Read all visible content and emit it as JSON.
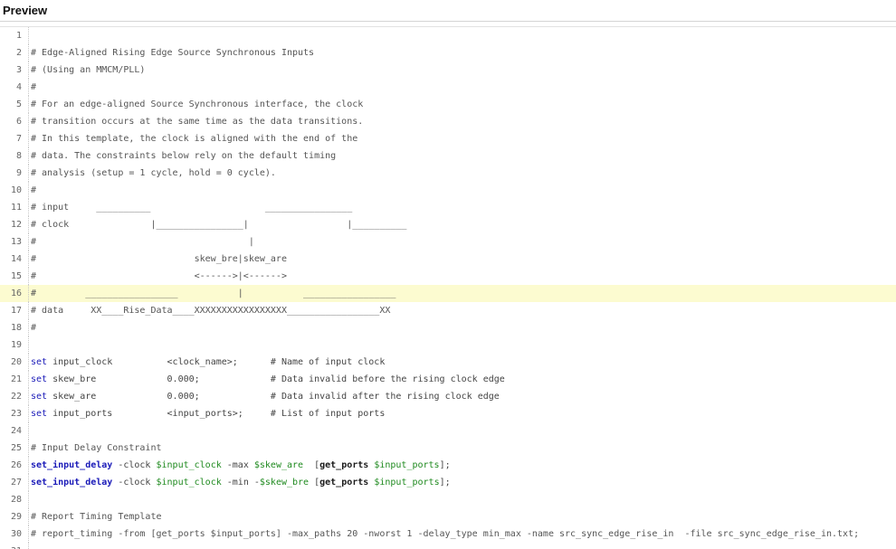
{
  "panel": {
    "title": "Preview"
  },
  "editor": {
    "highlight_line": 16,
    "lines": [
      {
        "n": "1",
        "text": ""
      },
      {
        "n": "2",
        "text": "# Edge-Aligned Rising Edge Source Synchronous Inputs"
      },
      {
        "n": "3",
        "text": "# (Using an MMCM/PLL)"
      },
      {
        "n": "4",
        "text": "#"
      },
      {
        "n": "5",
        "text": "# For an edge-aligned Source Synchronous interface, the clock"
      },
      {
        "n": "6",
        "text": "# transition occurs at the same time as the data transitions."
      },
      {
        "n": "7",
        "text": "# In this template, the clock is aligned with the end of the"
      },
      {
        "n": "8",
        "text": "# data. The constraints below rely on the default timing"
      },
      {
        "n": "9",
        "text": "# analysis (setup = 1 cycle, hold = 0 cycle)."
      },
      {
        "n": "10",
        "text": "#"
      },
      {
        "n": "11",
        "text": "# input     __________                     ________________"
      },
      {
        "n": "12",
        "text": "# clock               |________________|                  |__________"
      },
      {
        "n": "13",
        "text": "#                                       |"
      },
      {
        "n": "14",
        "text": "#                             skew_bre|skew_are"
      },
      {
        "n": "15",
        "text": "#                             <------>|<------>"
      },
      {
        "n": "16",
        "text": "#         _________________           |           _________________"
      },
      {
        "n": "17",
        "text": "# data     XX____Rise_Data____XXXXXXXXXXXXXXXXX_________________XX"
      },
      {
        "n": "18",
        "text": "#"
      },
      {
        "n": "19",
        "text": ""
      },
      {
        "n": "20",
        "segments": [
          {
            "t": "set ",
            "c": "tok-set"
          },
          {
            "t": "input_clock          <clock_name>;      # Name of input clock",
            "c": "tok-plain"
          }
        ]
      },
      {
        "n": "21",
        "segments": [
          {
            "t": "set ",
            "c": "tok-set"
          },
          {
            "t": "skew_bre             0.000;             # Data invalid before the rising clock edge",
            "c": "tok-plain"
          }
        ]
      },
      {
        "n": "22",
        "segments": [
          {
            "t": "set ",
            "c": "tok-set"
          },
          {
            "t": "skew_are             0.000;             # Data invalid after the rising clock edge",
            "c": "tok-plain"
          }
        ]
      },
      {
        "n": "23",
        "segments": [
          {
            "t": "set ",
            "c": "tok-set"
          },
          {
            "t": "input_ports          <input_ports>;     # List of input ports",
            "c": "tok-plain"
          }
        ]
      },
      {
        "n": "24",
        "text": ""
      },
      {
        "n": "25",
        "text": "# Input Delay Constraint"
      },
      {
        "n": "26",
        "segments": [
          {
            "t": "set_input_delay",
            "c": "tok-keyword"
          },
          {
            "t": " -clock ",
            "c": "tok-plain"
          },
          {
            "t": "$input_clock",
            "c": "tok-var"
          },
          {
            "t": " -max ",
            "c": "tok-plain"
          },
          {
            "t": "$skew_are",
            "c": "tok-var"
          },
          {
            "t": "  [",
            "c": "tok-plain"
          },
          {
            "t": "get_ports",
            "c": "tok-cmd"
          },
          {
            "t": " ",
            "c": "tok-plain"
          },
          {
            "t": "$input_ports",
            "c": "tok-var"
          },
          {
            "t": "];",
            "c": "tok-plain"
          }
        ]
      },
      {
        "n": "27",
        "segments": [
          {
            "t": "set_input_delay",
            "c": "tok-keyword"
          },
          {
            "t": " -clock ",
            "c": "tok-plain"
          },
          {
            "t": "$input_clock",
            "c": "tok-var"
          },
          {
            "t": " -min -",
            "c": "tok-plain"
          },
          {
            "t": "$skew_bre",
            "c": "tok-var"
          },
          {
            "t": " [",
            "c": "tok-plain"
          },
          {
            "t": "get_ports",
            "c": "tok-cmd"
          },
          {
            "t": " ",
            "c": "tok-plain"
          },
          {
            "t": "$input_ports",
            "c": "tok-var"
          },
          {
            "t": "];",
            "c": "tok-plain"
          }
        ]
      },
      {
        "n": "28",
        "text": ""
      },
      {
        "n": "29",
        "text": "# Report Timing Template"
      },
      {
        "n": "30",
        "text": "# report_timing -from [get_ports $input_ports] -max_paths 20 -nworst 1 -delay_type min_max -name src_sync_edge_rise_in  -file src_sync_edge_rise_in.txt;"
      },
      {
        "n": "31",
        "text": ""
      }
    ]
  }
}
